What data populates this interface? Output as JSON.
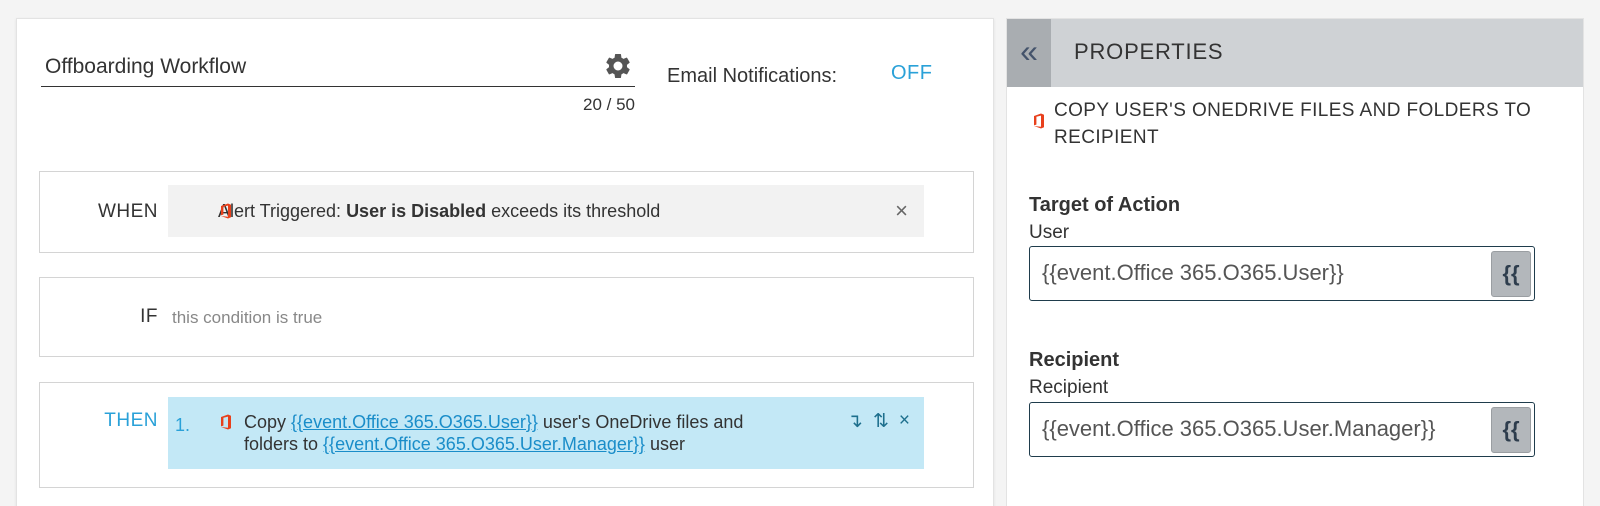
{
  "workflow": {
    "title": "Offboarding Workflow",
    "char_count": "20 / 50",
    "email_label": "Email Notifications:",
    "email_toggle": "OFF"
  },
  "when": {
    "label": "WHEN",
    "prefix": "Alert Triggered: ",
    "bold": "User is Disabled",
    "suffix": " exceeds its threshold",
    "remove": "×"
  },
  "if": {
    "label": "IF",
    "text": "this condition is true"
  },
  "then": {
    "label": "THEN",
    "items": [
      {
        "number": "1.",
        "t1": "Copy ",
        "link1": "{{event.Office 365.O365.User}}",
        "t2": " user's OneDrive files and folders to ",
        "link2": "{{event.Office 365.O365.User.Manager}}",
        "t3": " user"
      }
    ],
    "actions": {
      "indent": "↴",
      "reorder": "⇅",
      "remove": "×"
    }
  },
  "properties": {
    "collapse": "«",
    "title": "PROPERTIES",
    "action_title": "COPY USER'S ONEDRIVE FILES AND FOLDERS TO RECIPIENT",
    "target": {
      "heading": "Target of Action",
      "sublabel": "User",
      "value": "{{event.Office 365.O365.User}}"
    },
    "recipient": {
      "heading": "Recipient",
      "sublabel": "Recipient",
      "value": "{{event.Office 365.O365.User.Manager}}"
    },
    "var_button": "{{"
  },
  "colors": {
    "accent": "#2aa1d8",
    "office_red": "#e8401c",
    "then_highlight": "#c3e8f6",
    "panel_header": "#cfd2d5"
  }
}
